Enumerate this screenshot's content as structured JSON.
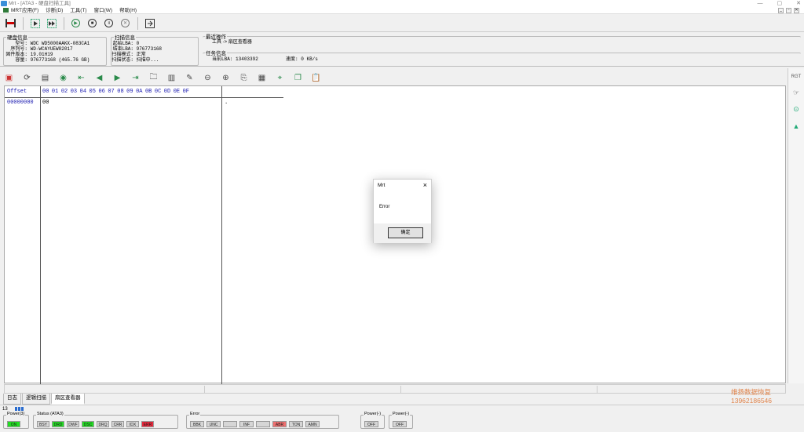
{
  "titlebar": {
    "title": "Mrt - [ATA3 - 硬盘扫描工具]",
    "controls": [
      "—",
      "▢",
      "✕"
    ]
  },
  "menu": {
    "items": [
      "MRT应用(F)",
      "诊断(D)",
      "工具(T)",
      "窗口(W)",
      "帮助(H)"
    ],
    "mdi_controls": [
      "_",
      "▫",
      "✕"
    ]
  },
  "disk_info": {
    "legend": "硬盘信息",
    "rows": [
      {
        "label": "型号:",
        "value": "WDC WD5000AAKX-083CA1"
      },
      {
        "label": "序列号:",
        "value": "WD-WCAYUEW82017"
      },
      {
        "label": "固件版本:",
        "value": "19.01H19"
      },
      {
        "label": "容量:",
        "value": "976773168 (465.76 GB)"
      }
    ]
  },
  "scan_info": {
    "legend": "扫描信息",
    "rows": [
      {
        "label": "起始LBA:",
        "value": "0"
      },
      {
        "label": "结束LBA:",
        "value": "976773168"
      },
      {
        "label": "扫描模式:",
        "value": "正常"
      },
      {
        "label": "扫描状态:",
        "value": "扫描中..."
      }
    ]
  },
  "recent_op": {
    "legend": "最近操作",
    "text": "工具 -> 扇区查看器"
  },
  "task_info": {
    "legend": "任务信息",
    "lba_label": "当前LBA:",
    "lba_value": "13403392",
    "speed_label": "速度:",
    "speed_value": "0 KB/s"
  },
  "hex": {
    "offset_header": "Offset",
    "byte_headers": [
      "00",
      "01",
      "02",
      "03",
      "04",
      "05",
      "06",
      "07",
      "08",
      "09",
      "0A",
      "0B",
      "0C",
      "0D",
      "0E",
      "0F"
    ],
    "row_offset": "00000000",
    "row_bytes": "00",
    "row_ascii": "."
  },
  "tabs": [
    "日志",
    "逻辑扫描",
    "扇区查看器"
  ],
  "watermark": {
    "line1": "维扬数据恢复",
    "line2": "13962186546"
  },
  "statusbar": {
    "number": "13",
    "power3": {
      "label": "Power(3)",
      "leds": [
        {
          "t": "ON",
          "c": "#22dd22",
          "w": 17
        }
      ]
    },
    "status": {
      "label": "Status (ATA3)",
      "leds": [
        {
          "t": "BSY",
          "c": "#d6d6d6",
          "w": 16
        },
        {
          "t": "DRD",
          "c": "#22dd22",
          "w": 16
        },
        {
          "t": "DWF",
          "c": "#d6d6d6",
          "w": 16
        },
        {
          "t": "DSC",
          "c": "#22dd22",
          "w": 16
        },
        {
          "t": "DRQ",
          "c": "#d6d6d6",
          "w": 16
        },
        {
          "t": "CRR",
          "c": "#d6d6d6",
          "w": 16
        },
        {
          "t": "IDX",
          "c": "#d6d6d6",
          "w": 16
        },
        {
          "t": "ERR",
          "c": "#e8283c",
          "w": 16
        }
      ]
    },
    "error": {
      "label": "Error",
      "leds": [
        {
          "t": "BBK",
          "c": "#d6d6d6",
          "w": 18
        },
        {
          "t": "UNC",
          "c": "#d6d6d6",
          "w": 18
        },
        {
          "t": "",
          "c": "#d6d6d6",
          "w": 18
        },
        {
          "t": "INF",
          "c": "#d6d6d6",
          "w": 18
        },
        {
          "t": "",
          "c": "#d6d6d6",
          "w": 18
        },
        {
          "t": "ABR",
          "c": "#ee7070",
          "w": 18
        },
        {
          "t": "TON",
          "c": "#d6d6d6",
          "w": 18
        },
        {
          "t": "AMN",
          "c": "#d6d6d6",
          "w": 18
        }
      ]
    },
    "powerA": {
      "label": "Power(-)",
      "leds": [
        {
          "t": "OFF",
          "c": "#d6d6d6",
          "w": 18
        }
      ]
    },
    "powerB": {
      "label": "Power(-)",
      "leds": [
        {
          "t": "OFF",
          "c": "#d6d6d6",
          "w": 18
        }
      ]
    }
  },
  "dialog": {
    "title": "Mrt",
    "message": "Error",
    "ok_label": "确定"
  }
}
